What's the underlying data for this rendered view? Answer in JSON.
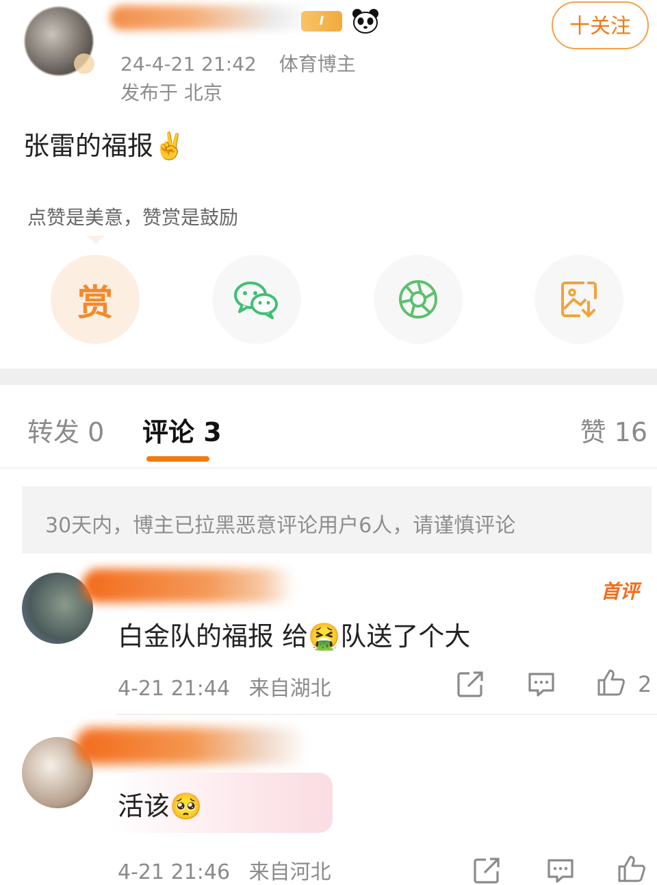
{
  "post": {
    "level": "I",
    "follow_label": "十关注",
    "time": "24-4-21 21:42",
    "role": "体育博主",
    "location": "发布于 北京",
    "text": "张雷的福报✌️"
  },
  "reward": {
    "hint": "点赞是美意，赞赏是鼓励",
    "reward_label": "赏"
  },
  "tabs": {
    "repost": "转发 0",
    "comment": "评论 3",
    "like": "赞 16"
  },
  "notice": "30天内，博主已拉黑恶意评论用户6人，请谨慎评论",
  "comments": [
    {
      "badge": "首评",
      "text": "白金队的福报  给🤮队送了个大",
      "time": "4-21 21:44",
      "location": "来自湖北",
      "likes": "2"
    },
    {
      "text": "活该🥺",
      "time": "4-21 21:46",
      "location": "来自河北"
    }
  ],
  "colors": {
    "accent": "#ee7b14",
    "wechat": "#3fc074",
    "moments": "#5cc06c",
    "save": "#f2a23a"
  }
}
